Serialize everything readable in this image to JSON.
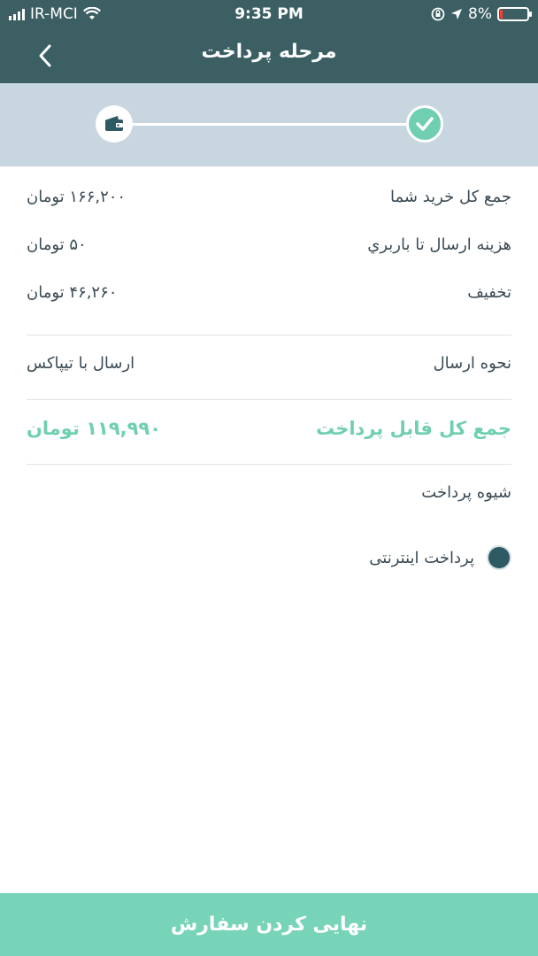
{
  "status_bar": {
    "carrier": "IR-MCI",
    "time": "9:35 PM",
    "battery": "8%"
  },
  "header": {
    "title": "مرحله پرداخت"
  },
  "stepper": {
    "steps": [
      {
        "icon": "wallet-icon",
        "state": "current"
      },
      {
        "icon": "check-icon",
        "state": "done"
      }
    ],
    "colors": {
      "done": "#6fcfb0",
      "background": "#c8d6df"
    }
  },
  "summary": {
    "total_label": "جمع کل خرید شما",
    "total_value": "۱۶۶,۲۰۰ تومان",
    "shipping_label": "هزینه ارسال تا باربري",
    "shipping_value": "۵۰ تومان",
    "discount_label": "تخفیف",
    "discount_value": "۴۶,۲۶۰ تومان"
  },
  "shipping_method": {
    "label": "نحوه ارسال",
    "value": "ارسال با تیپاکس"
  },
  "payable": {
    "label": "جمع کل قابل پرداخت",
    "value": "۱۱۹,۹۹۰ تومان",
    "color": "#6fcfb0"
  },
  "payment": {
    "label": "شیوه پرداخت",
    "options": [
      {
        "label": "پرداخت اینترنتی",
        "selected": true
      }
    ]
  },
  "footer": {
    "button_label": "نهایی کردن سفارش",
    "color": "#78d4b8"
  }
}
